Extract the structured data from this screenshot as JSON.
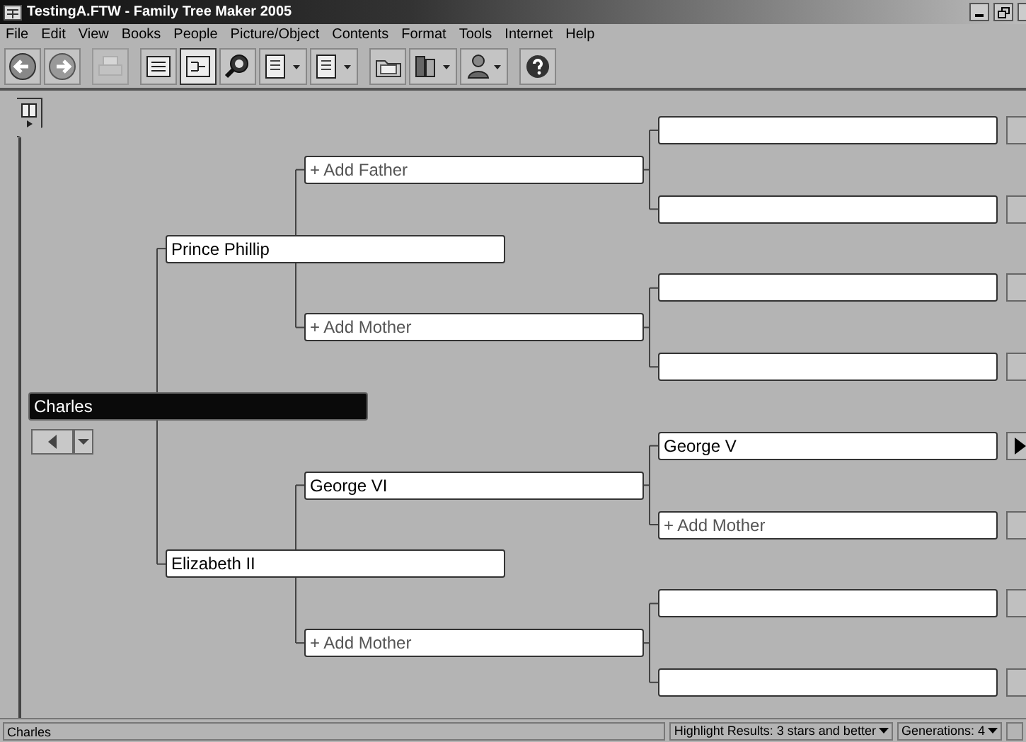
{
  "window": {
    "title": "TestingA.FTW - Family Tree Maker 2005"
  },
  "menu": [
    "File",
    "Edit",
    "View",
    "Books",
    "People",
    "Picture/Object",
    "Contents",
    "Format",
    "Tools",
    "Internet",
    "Help"
  ],
  "toolbar": [
    [
      {
        "kind": "back",
        "pressed": false,
        "disabled": false
      },
      {
        "kind": "forward",
        "pressed": false,
        "disabled": false
      }
    ],
    [
      {
        "kind": "print",
        "pressed": false,
        "disabled": true
      }
    ],
    [
      {
        "kind": "pedigree",
        "pressed": false,
        "disabled": false
      },
      {
        "kind": "family",
        "pressed": true,
        "disabled": false
      },
      {
        "kind": "search",
        "pressed": false,
        "disabled": false
      },
      {
        "kind": "index",
        "pressed": false,
        "disabled": false
      },
      {
        "kind": "page",
        "pressed": false,
        "disabled": false
      }
    ],
    [
      {
        "kind": "folder",
        "pressed": false,
        "disabled": false
      },
      {
        "kind": "books",
        "pressed": false,
        "disabled": false
      },
      {
        "kind": "person",
        "pressed": false,
        "disabled": false
      }
    ],
    [
      {
        "kind": "help",
        "pressed": false,
        "disabled": false
      }
    ]
  ],
  "pedigree": {
    "root": {
      "kind": "person",
      "name": "Charles",
      "selected": true,
      "parents": [
        {
          "kind": "person",
          "name": "Prince Phillip",
          "selected": false,
          "parents": [
            {
              "kind": "add",
              "label": "+ Add Father",
              "parents": [
                {
                  "kind": "empty",
                  "more": false
                },
                {
                  "kind": "empty",
                  "more": false
                }
              ]
            },
            {
              "kind": "add",
              "label": "+ Add Mother",
              "parents": [
                {
                  "kind": "empty",
                  "more": false
                },
                {
                  "kind": "empty",
                  "more": false
                }
              ]
            }
          ]
        },
        {
          "kind": "person",
          "name": "Elizabeth II",
          "selected": false,
          "parents": [
            {
              "kind": "person",
              "name": "George VI",
              "selected": false,
              "parents": [
                {
                  "kind": "person",
                  "name": "George V",
                  "selected": false,
                  "more": true
                },
                {
                  "kind": "add",
                  "label": "+ Add Mother",
                  "more": false
                }
              ]
            },
            {
              "kind": "add",
              "label": "+ Add Mother",
              "parents": [
                {
                  "kind": "empty",
                  "more": false
                },
                {
                  "kind": "empty",
                  "more": false
                }
              ]
            }
          ]
        }
      ]
    }
  },
  "status_bar": {
    "person": "Charles",
    "highlight": "Highlight Results: 3 stars and better",
    "generations": "Generations: 4"
  }
}
